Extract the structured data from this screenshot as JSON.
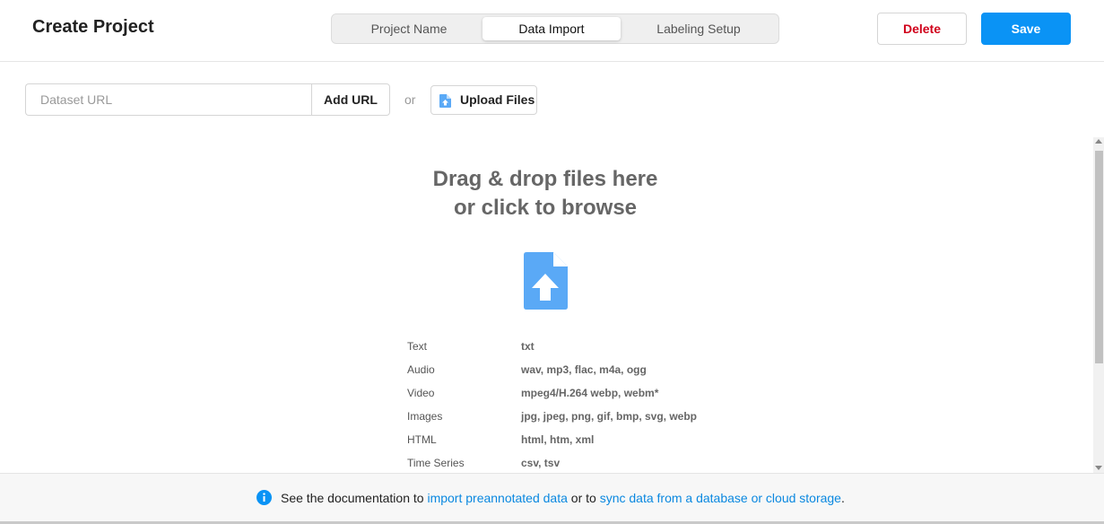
{
  "header": {
    "title": "Create Project",
    "tabs": [
      {
        "label": "Project Name"
      },
      {
        "label": "Data Import"
      },
      {
        "label": "Labeling Setup"
      }
    ],
    "active_tab": "Data Import",
    "delete_label": "Delete",
    "save_label": "Save"
  },
  "import_bar": {
    "url_placeholder": "Dataset URL",
    "url_value": "",
    "add_url_label": "Add URL",
    "or_label": "or",
    "upload_label": "Upload Files"
  },
  "dropzone": {
    "title_line1": "Drag & drop files here",
    "title_line2": "or click to browse",
    "icon": "file-upload-icon",
    "file_types": [
      {
        "name": "Text",
        "extensions": "txt"
      },
      {
        "name": "Audio",
        "extensions": "wav, mp3, flac, m4a, ogg"
      },
      {
        "name": "Video",
        "extensions": "mpeg4/H.264 webp, webm*"
      },
      {
        "name": "Images",
        "extensions": "jpg, jpeg, png, gif, bmp, svg, webp"
      },
      {
        "name": "HTML",
        "extensions": "html, htm, xml"
      },
      {
        "name": "Time Series",
        "extensions": "csv, tsv"
      }
    ]
  },
  "footer": {
    "icon": "info-icon",
    "text_before": "See the documentation to ",
    "link1": "import preannotated data",
    "text_middle": " or to ",
    "link2": "sync data from a database or cloud storage",
    "text_after": "."
  },
  "colors": {
    "accent": "#0a93f5",
    "danger": "#d0021b",
    "link": "#0a88e0",
    "icon_blue": "#5aa9f6"
  }
}
